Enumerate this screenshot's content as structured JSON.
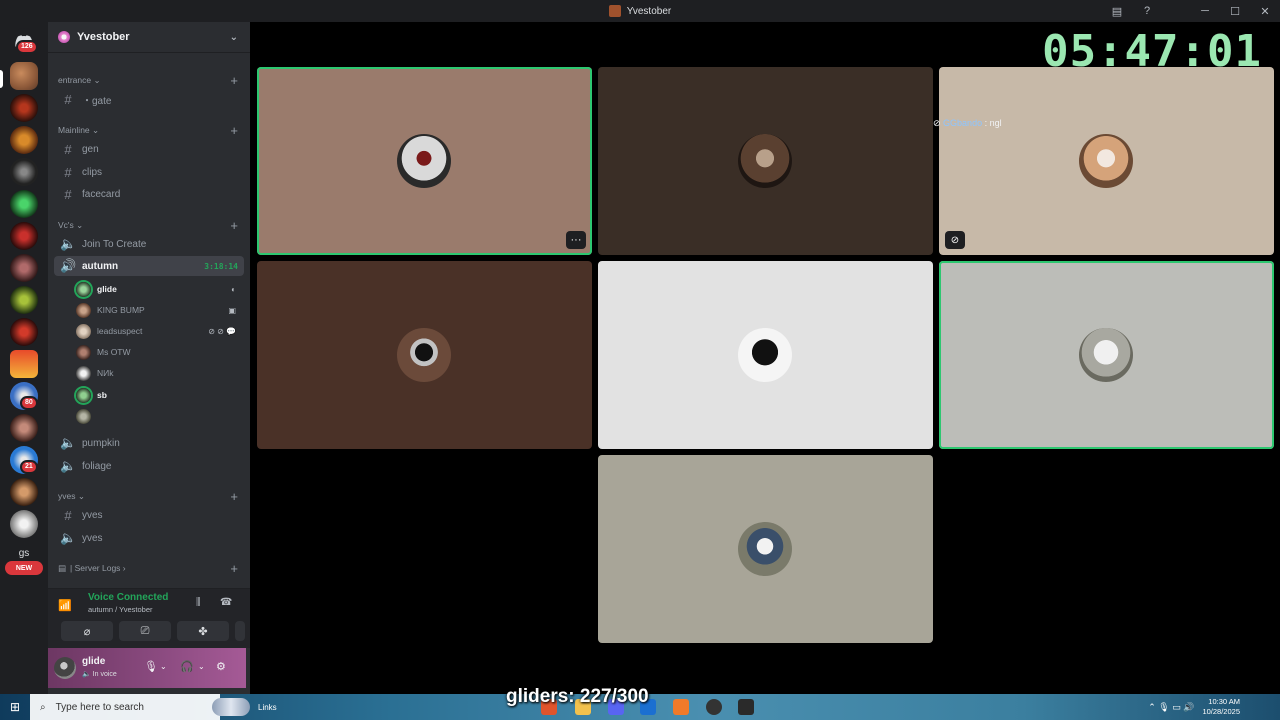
{
  "window": {
    "title": "Yvestober"
  },
  "rail": {
    "dm_badge": "126",
    "badge_80": "80",
    "badge_21": "21",
    "new_label": "NEW",
    "gs_label": "gs"
  },
  "server": {
    "name": "Yvestober",
    "categories": {
      "entrance": "entrance",
      "mainline": "Mainline",
      "vcs": "Vc's",
      "yves": "yves",
      "logs": "| Server Logs"
    },
    "channels": {
      "gate": "・gate",
      "gen": "gen",
      "clips": "clips",
      "facecard": "facecard",
      "join_to_create": "Join To Create",
      "autumn": "autumn",
      "pumpkin": "pumpkin",
      "foliage": "foliage",
      "yves_text": "yves",
      "yves_voice": "yves"
    },
    "autumn_timer": "3:18:14",
    "voice_users": [
      "glide",
      "KING BUMP",
      "leadsuspect",
      "Ms OTW",
      "NИk",
      "sb",
      ""
    ]
  },
  "voice": {
    "status": "Voice Connected",
    "location": "autumn / Yvestober"
  },
  "user": {
    "name": "glide",
    "status": "In voice"
  },
  "stage": {
    "clock": "05:47:01",
    "caption_name": "GGbando",
    "caption_text": ": ngl",
    "more_label": "···"
  },
  "colors": {
    "speaking": "#2dc770",
    "voice_green": "#23a55a",
    "clock": "#9be7b1"
  },
  "taskbar": {
    "search_placeholder": "Type here to search",
    "links_label": "Links",
    "overlay": "gliders: 227/300",
    "time": "10:30 AM",
    "date": "10/28/2025"
  }
}
